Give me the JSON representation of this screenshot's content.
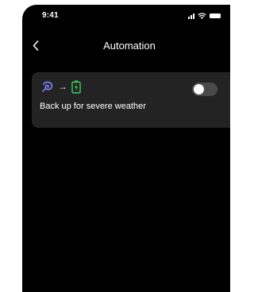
{
  "status_bar": {
    "time": "9:41",
    "icons": [
      "signal-icon",
      "wifi-icon",
      "battery-icon"
    ]
  },
  "nav": {
    "back_icon": "chevron-left-icon",
    "title": "Automation"
  },
  "automation_rule": {
    "trigger_icon": "storm-icon",
    "arrow": "→",
    "action_icon": "battery-charging-icon",
    "label": "Back up for severe weather",
    "enabled": false
  },
  "colors": {
    "background": "#000000",
    "card": "#232323",
    "trigger_icon": "#7b7ff5",
    "action_icon": "#37d15a",
    "toggle_off": "#4a4a4a"
  }
}
